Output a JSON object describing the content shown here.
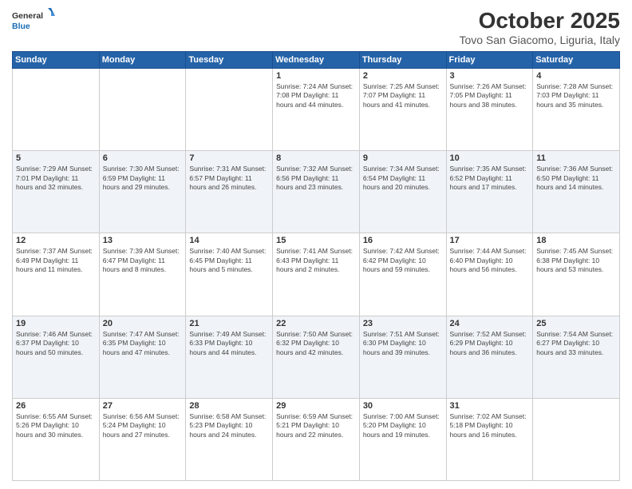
{
  "header": {
    "logo_general": "General",
    "logo_blue": "Blue",
    "month_title": "October 2025",
    "location": "Tovo San Giacomo, Liguria, Italy"
  },
  "weekdays": [
    "Sunday",
    "Monday",
    "Tuesday",
    "Wednesday",
    "Thursday",
    "Friday",
    "Saturday"
  ],
  "weeks": [
    [
      {
        "day": "",
        "info": ""
      },
      {
        "day": "",
        "info": ""
      },
      {
        "day": "",
        "info": ""
      },
      {
        "day": "1",
        "info": "Sunrise: 7:24 AM\nSunset: 7:08 PM\nDaylight: 11 hours\nand 44 minutes."
      },
      {
        "day": "2",
        "info": "Sunrise: 7:25 AM\nSunset: 7:07 PM\nDaylight: 11 hours\nand 41 minutes."
      },
      {
        "day": "3",
        "info": "Sunrise: 7:26 AM\nSunset: 7:05 PM\nDaylight: 11 hours\nand 38 minutes."
      },
      {
        "day": "4",
        "info": "Sunrise: 7:28 AM\nSunset: 7:03 PM\nDaylight: 11 hours\nand 35 minutes."
      }
    ],
    [
      {
        "day": "5",
        "info": "Sunrise: 7:29 AM\nSunset: 7:01 PM\nDaylight: 11 hours\nand 32 minutes."
      },
      {
        "day": "6",
        "info": "Sunrise: 7:30 AM\nSunset: 6:59 PM\nDaylight: 11 hours\nand 29 minutes."
      },
      {
        "day": "7",
        "info": "Sunrise: 7:31 AM\nSunset: 6:57 PM\nDaylight: 11 hours\nand 26 minutes."
      },
      {
        "day": "8",
        "info": "Sunrise: 7:32 AM\nSunset: 6:56 PM\nDaylight: 11 hours\nand 23 minutes."
      },
      {
        "day": "9",
        "info": "Sunrise: 7:34 AM\nSunset: 6:54 PM\nDaylight: 11 hours\nand 20 minutes."
      },
      {
        "day": "10",
        "info": "Sunrise: 7:35 AM\nSunset: 6:52 PM\nDaylight: 11 hours\nand 17 minutes."
      },
      {
        "day": "11",
        "info": "Sunrise: 7:36 AM\nSunset: 6:50 PM\nDaylight: 11 hours\nand 14 minutes."
      }
    ],
    [
      {
        "day": "12",
        "info": "Sunrise: 7:37 AM\nSunset: 6:49 PM\nDaylight: 11 hours\nand 11 minutes."
      },
      {
        "day": "13",
        "info": "Sunrise: 7:39 AM\nSunset: 6:47 PM\nDaylight: 11 hours\nand 8 minutes."
      },
      {
        "day": "14",
        "info": "Sunrise: 7:40 AM\nSunset: 6:45 PM\nDaylight: 11 hours\nand 5 minutes."
      },
      {
        "day": "15",
        "info": "Sunrise: 7:41 AM\nSunset: 6:43 PM\nDaylight: 11 hours\nand 2 minutes."
      },
      {
        "day": "16",
        "info": "Sunrise: 7:42 AM\nSunset: 6:42 PM\nDaylight: 10 hours\nand 59 minutes."
      },
      {
        "day": "17",
        "info": "Sunrise: 7:44 AM\nSunset: 6:40 PM\nDaylight: 10 hours\nand 56 minutes."
      },
      {
        "day": "18",
        "info": "Sunrise: 7:45 AM\nSunset: 6:38 PM\nDaylight: 10 hours\nand 53 minutes."
      }
    ],
    [
      {
        "day": "19",
        "info": "Sunrise: 7:46 AM\nSunset: 6:37 PM\nDaylight: 10 hours\nand 50 minutes."
      },
      {
        "day": "20",
        "info": "Sunrise: 7:47 AM\nSunset: 6:35 PM\nDaylight: 10 hours\nand 47 minutes."
      },
      {
        "day": "21",
        "info": "Sunrise: 7:49 AM\nSunset: 6:33 PM\nDaylight: 10 hours\nand 44 minutes."
      },
      {
        "day": "22",
        "info": "Sunrise: 7:50 AM\nSunset: 6:32 PM\nDaylight: 10 hours\nand 42 minutes."
      },
      {
        "day": "23",
        "info": "Sunrise: 7:51 AM\nSunset: 6:30 PM\nDaylight: 10 hours\nand 39 minutes."
      },
      {
        "day": "24",
        "info": "Sunrise: 7:52 AM\nSunset: 6:29 PM\nDaylight: 10 hours\nand 36 minutes."
      },
      {
        "day": "25",
        "info": "Sunrise: 7:54 AM\nSunset: 6:27 PM\nDaylight: 10 hours\nand 33 minutes."
      }
    ],
    [
      {
        "day": "26",
        "info": "Sunrise: 6:55 AM\nSunset: 5:26 PM\nDaylight: 10 hours\nand 30 minutes."
      },
      {
        "day": "27",
        "info": "Sunrise: 6:56 AM\nSunset: 5:24 PM\nDaylight: 10 hours\nand 27 minutes."
      },
      {
        "day": "28",
        "info": "Sunrise: 6:58 AM\nSunset: 5:23 PM\nDaylight: 10 hours\nand 24 minutes."
      },
      {
        "day": "29",
        "info": "Sunrise: 6:59 AM\nSunset: 5:21 PM\nDaylight: 10 hours\nand 22 minutes."
      },
      {
        "day": "30",
        "info": "Sunrise: 7:00 AM\nSunset: 5:20 PM\nDaylight: 10 hours\nand 19 minutes."
      },
      {
        "day": "31",
        "info": "Sunrise: 7:02 AM\nSunset: 5:18 PM\nDaylight: 10 hours\nand 16 minutes."
      },
      {
        "day": "",
        "info": ""
      }
    ]
  ]
}
